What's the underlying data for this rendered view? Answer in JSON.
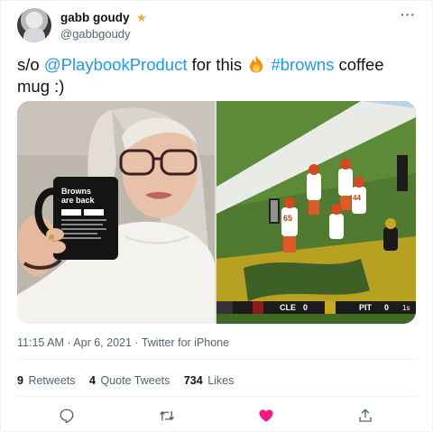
{
  "author": {
    "display_name": "gabb goudy",
    "handle": "@gabbgoudy"
  },
  "tweet": {
    "prefix": "s/o ",
    "mention": "@PlaybookProduct",
    "middle": " for this ",
    "emoji_name": "fire-icon",
    "hashtag": "#browns",
    "suffix": " coffee mug :)"
  },
  "media": {
    "left_photo": {
      "mug_line1": "Browns",
      "mug_line2": "are back"
    },
    "right_photo": {
      "scoreboard_team1": "CLE",
      "scoreboard_score1": "0",
      "scoreboard_team2": "PIT",
      "scoreboard_score2": "0",
      "scoreboard_quarter": "1s",
      "player_number_1": "65",
      "player_number_2": "44"
    }
  },
  "meta": {
    "timestamp": "11:15 AM · Apr 6, 2021 · Twitter for iPhone"
  },
  "stats": {
    "retweets_count": "9",
    "retweets_label": "Retweets",
    "quotes_count": "4",
    "quotes_label": "Quote Tweets",
    "likes_count": "734",
    "likes_label": "Likes"
  },
  "colors": {
    "accent": "#1d9bf0",
    "like": "#f91880",
    "verified_star": "#f5a623",
    "secondary_text": "#536471"
  }
}
